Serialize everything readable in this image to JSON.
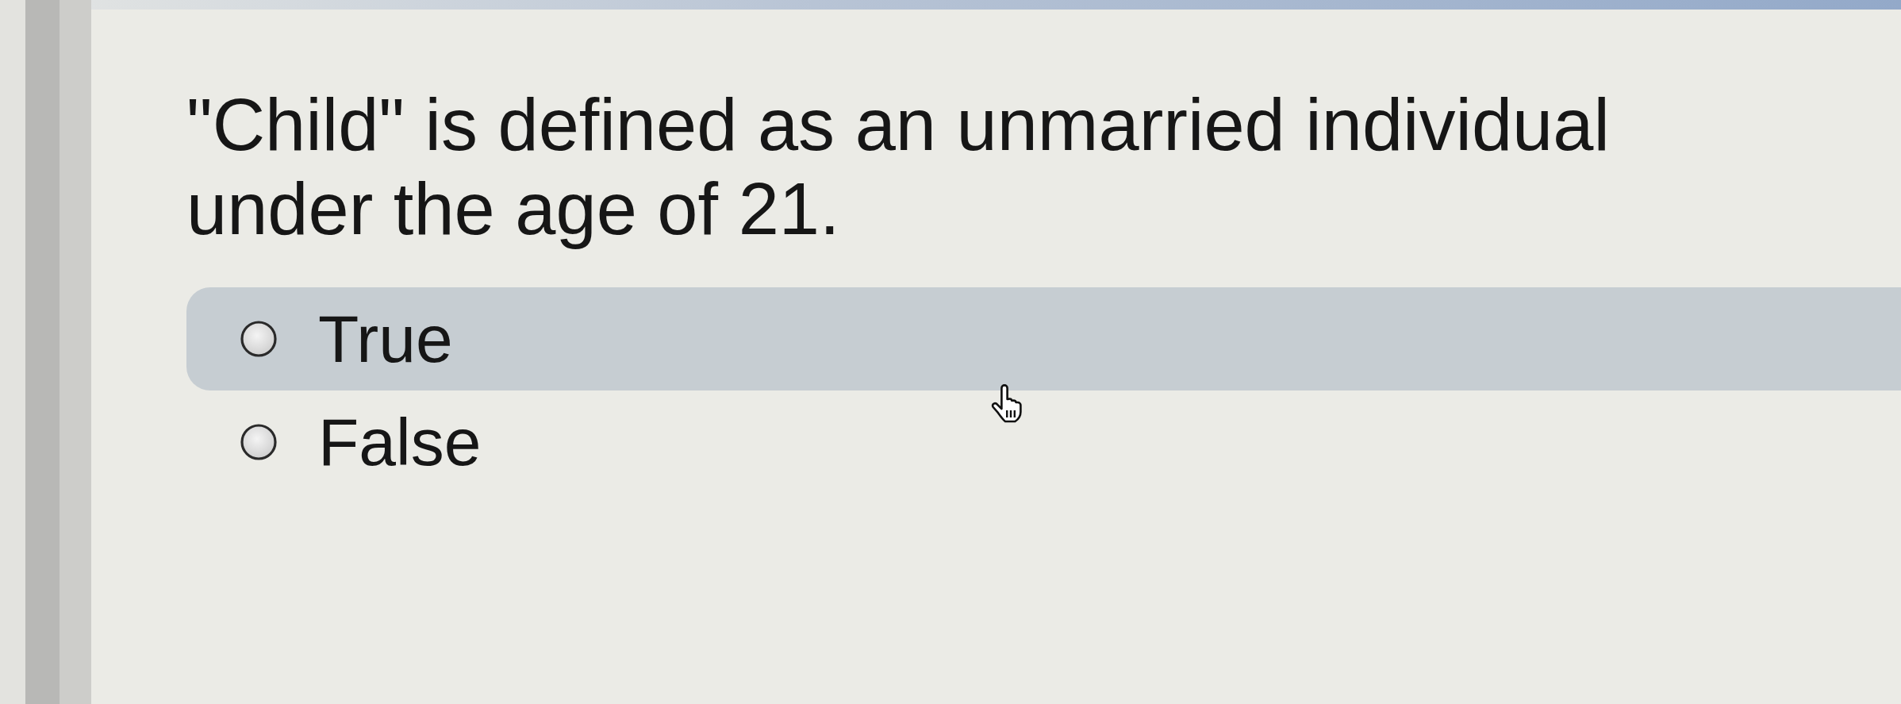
{
  "question": {
    "text": "\"Child\" is defined as an unmarried individual under the age of 21."
  },
  "options": [
    {
      "label": "True",
      "selected": false,
      "hovered": true
    },
    {
      "label": "False",
      "selected": false,
      "hovered": false
    }
  ]
}
